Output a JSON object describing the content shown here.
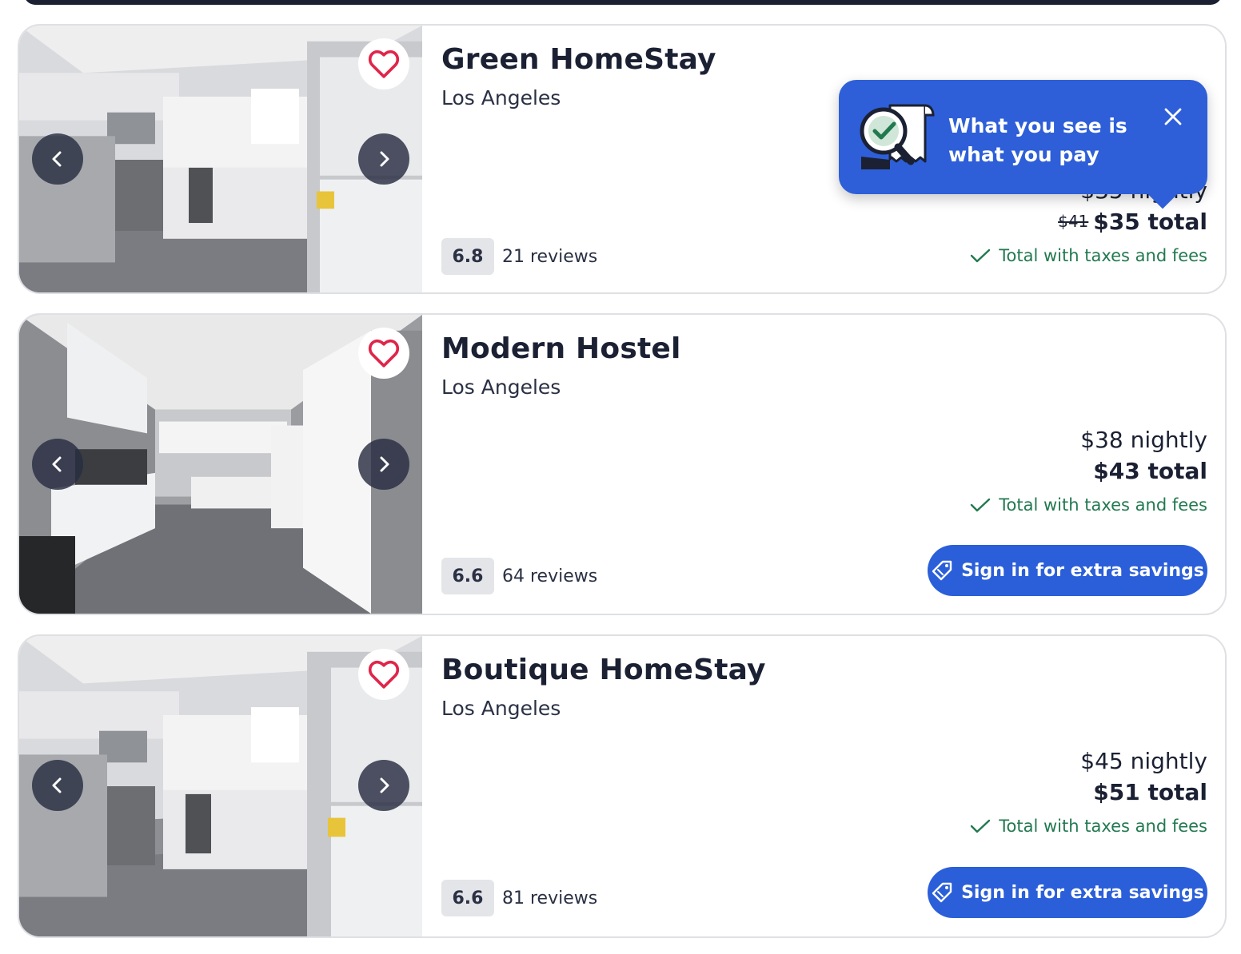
{
  "colors": {
    "primary": "#2b5fd9",
    "text_dark": "#1b2133",
    "positive_green": "#227950",
    "favorite_red": "#e0254a",
    "rating_bg": "#e4e5e9"
  },
  "icons": {
    "favorite": "heart-outline-icon",
    "prev": "chevron-left-icon",
    "next": "chevron-right-icon",
    "check": "check-icon",
    "tag": "price-tag-icon",
    "close": "close-icon",
    "receipt": "receipt-magnifier-icon"
  },
  "tooltip": {
    "text": "What you see is what you pay"
  },
  "listings": [
    {
      "name": "Green HomeStay",
      "city": "Los Angeles",
      "rating": "6.8",
      "reviews": "21 reviews",
      "nightly": "$35 nightly",
      "old_total": "$41",
      "total": "$35 total",
      "taxes_note": "Total with taxes and fees"
    },
    {
      "name": "Modern Hostel",
      "city": "Los Angeles",
      "rating": "6.6",
      "reviews": "64 reviews",
      "nightly": "$38 nightly",
      "total": "$43 total",
      "taxes_note": "Total with taxes and fees",
      "cta": "Sign in for extra savings"
    },
    {
      "name": "Boutique HomeStay",
      "city": "Los Angeles",
      "rating": "6.6",
      "reviews": "81 reviews",
      "nightly": "$45 nightly",
      "total": "$51 total",
      "taxes_note": "Total with taxes and fees",
      "cta": "Sign in for extra savings"
    }
  ]
}
